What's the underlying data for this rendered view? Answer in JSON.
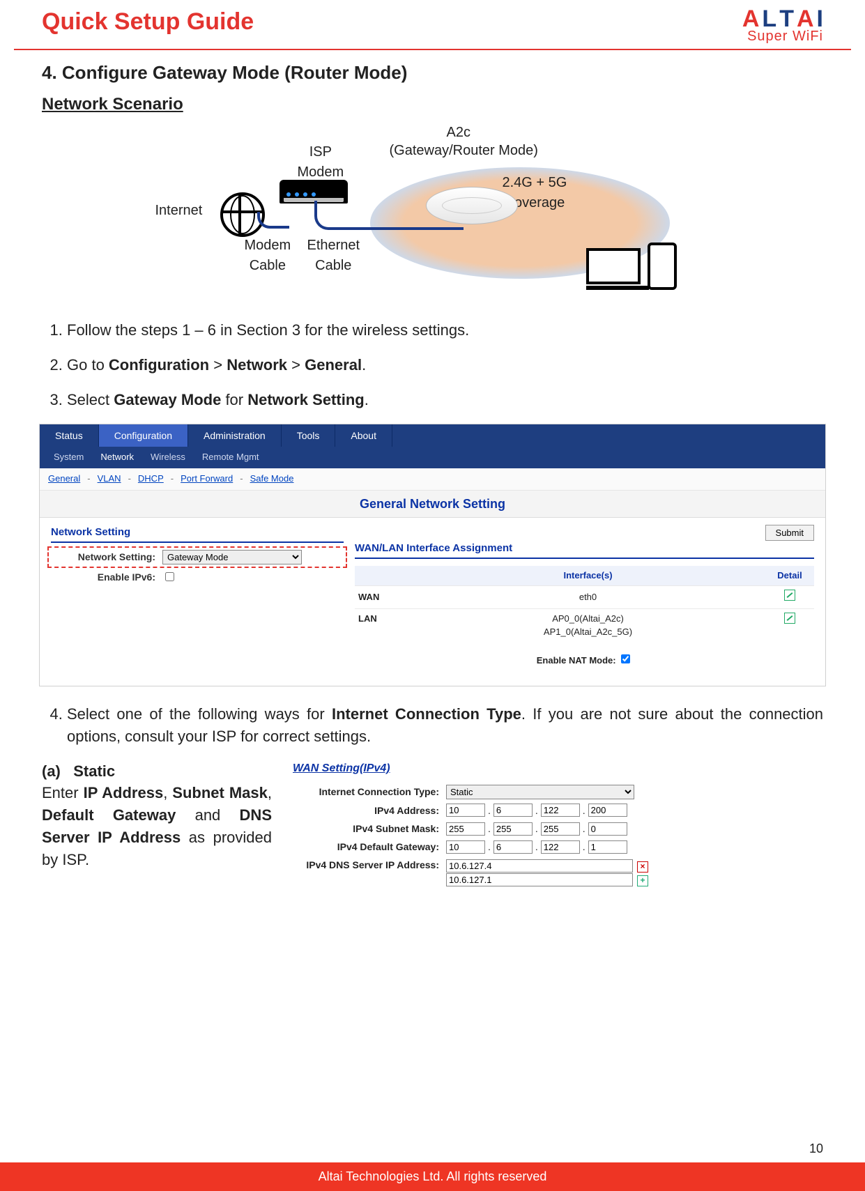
{
  "header": {
    "guide_title": "Quick Setup Guide",
    "brand": "ALTAI",
    "brand_sub": "Super WiFi"
  },
  "section": {
    "num_title": "4. Configure Gateway Mode (Router Mode)",
    "scenario": "Network Scenario"
  },
  "diagram": {
    "internet": "Internet",
    "isp_modem": "ISP\nModem",
    "modem_cable": "Modem\nCable",
    "eth_cable": "Ethernet\nCable",
    "ap": "A2c",
    "ap_mode": "(Gateway/Router Mode)",
    "coverage": "2.4G + 5G\nCoverage"
  },
  "steps": {
    "s1": "Follow the steps 1 – 6 in Section 3 for the wireless settings.",
    "s2_pre": "Go to ",
    "s2_a": "Configuration",
    "s2_b": "Network",
    "s2_c": "General",
    "gt": ">",
    "s3_pre": "Select ",
    "s3_a": "Gateway Mode",
    "s3_mid": " for ",
    "s3_b": "Network Setting",
    "dot": ".",
    "s4_a": "Select one of the following ways for ",
    "s4_b": "Internet Connection Type",
    "s4_c": ". If you are not sure about the connection options, consult your ISP for correct settings."
  },
  "shot": {
    "tier1": [
      "Status",
      "Configuration",
      "Administration",
      "Tools",
      "About"
    ],
    "tier2": [
      "System",
      "Network",
      "Wireless",
      "Remote Mgmt"
    ],
    "tier3": [
      "General",
      "VLAN",
      "DHCP",
      "Port Forward",
      "Safe Mode"
    ],
    "title": "General Network Setting",
    "submit": "Submit",
    "left_title": "Network Setting",
    "ns_label": "Network Setting:",
    "ns_value": "Gateway Mode",
    "ipv6_label": "Enable IPv6:",
    "right_title": "WAN/LAN Interface Assignment",
    "th_blank": "",
    "th_if": "Interface(s)",
    "th_detail": "Detail",
    "rows": [
      {
        "side": "WAN",
        "iface": "eth0"
      },
      {
        "side": "LAN",
        "iface": "AP0_0(Altai_A2c)\nAP1_0(Altai_A2c_5G)"
      }
    ],
    "nat_label": "Enable NAT Mode:"
  },
  "static": {
    "opt": "(a)",
    "name": "Static",
    "para_pre": "Enter ",
    "f1": "IP Address",
    "c": ", ",
    "f2": "Subnet Mask",
    "f3": "Default Gateway",
    "and": " and ",
    "f4": "DNS Server IP Address",
    "para_post": " as provided by ISP."
  },
  "wan": {
    "title": "WAN Setting(IPv4)",
    "ict_label": "Internet Connection Type:",
    "ict_value": "Static",
    "addr_label": "IPv4 Address:",
    "addr": [
      "10",
      "6",
      "122",
      "200"
    ],
    "mask_label": "IPv4 Subnet Mask:",
    "mask": [
      "255",
      "255",
      "255",
      "0"
    ],
    "gw_label": "IPv4 Default Gateway:",
    "gw": [
      "10",
      "6",
      "122",
      "1"
    ],
    "dns_label": "IPv4 DNS Server IP Address:",
    "dns": [
      "10.6.127.4",
      "10.6.127.1"
    ]
  },
  "footer": {
    "text": "Altai Technologies Ltd. All rights reserved",
    "pgnum": "10"
  }
}
